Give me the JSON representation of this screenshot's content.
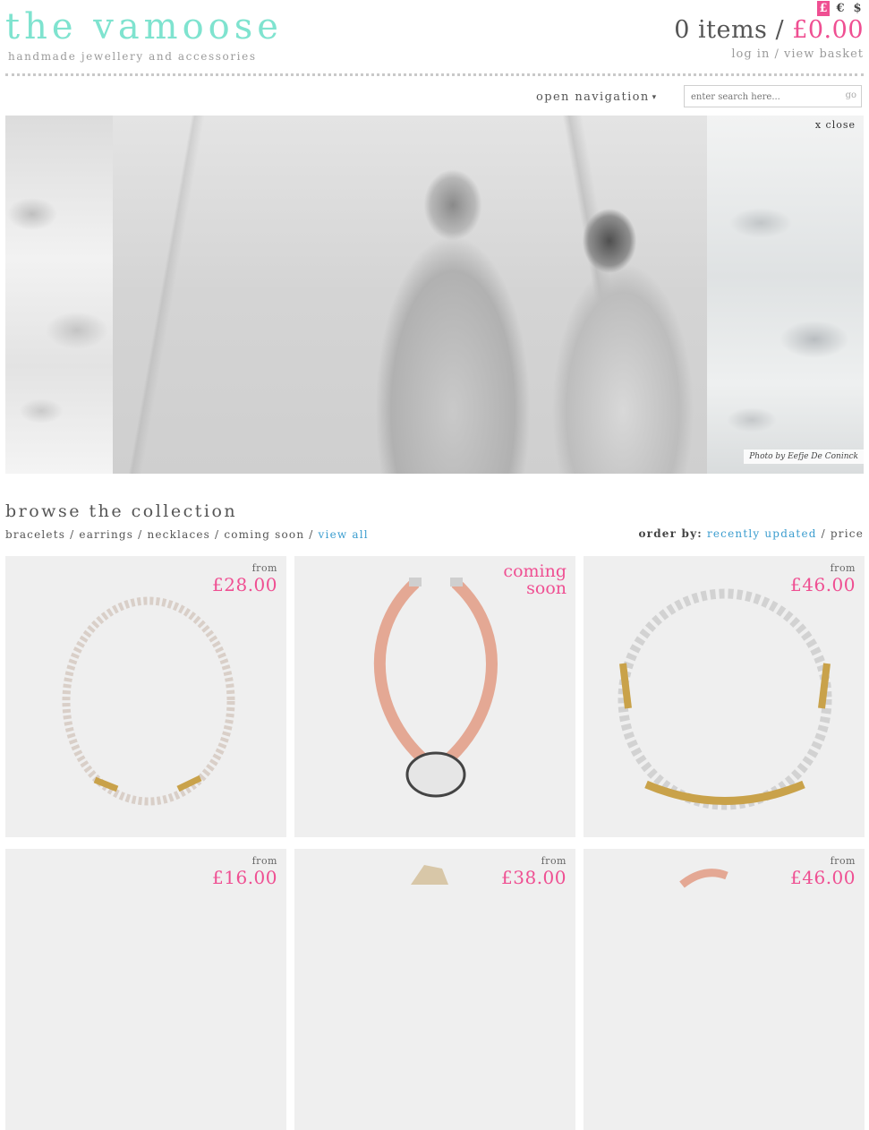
{
  "header": {
    "logo": "the vamoose",
    "tagline": "handmade jewellery and accessories",
    "currencies": [
      "£",
      "€",
      "$"
    ],
    "active_currency": "£",
    "basket_items": "0 items /",
    "basket_total": "£0.00",
    "login": "log in",
    "separator": "/",
    "view_basket": "view basket"
  },
  "nav": {
    "open_navigation": "open navigation",
    "search_placeholder": "enter search here...",
    "search_go": "go"
  },
  "hero": {
    "close": "x close",
    "photo_credit": "Photo by Eefje De Coninck"
  },
  "browse": {
    "title": "browse the collection",
    "categories": [
      "bracelets",
      "earrings",
      "necklaces",
      "coming soon"
    ],
    "view_all": "view all",
    "order_by_label": "order by:",
    "order_recent": "recently updated",
    "order_price": "price"
  },
  "products": [
    {
      "from": "from",
      "price": "£28.00"
    },
    {
      "coming_soon": [
        "coming",
        "soon"
      ]
    },
    {
      "from": "from",
      "price": "£46.00"
    },
    {
      "from": "from",
      "price": "£16.00"
    },
    {
      "from": "from",
      "price": "£38.00"
    },
    {
      "from": "from",
      "price": "£46.00"
    }
  ],
  "colors": {
    "brand_mint": "#7fe3cf",
    "accent_pink": "#ef4f92",
    "link_blue": "#3b9dcf"
  }
}
